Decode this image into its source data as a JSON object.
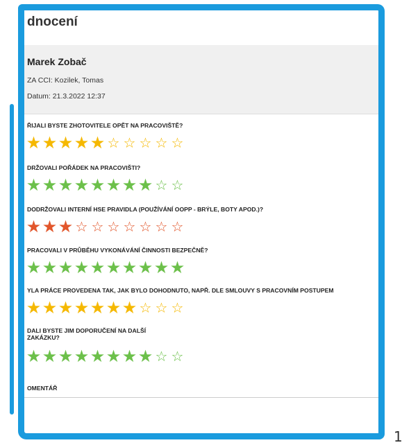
{
  "page_title": "dnocení",
  "card": {
    "name": "Marek Zobač",
    "company": "ZA CCI: Kozilek, Tomas",
    "datum": "Datum: 21.3.2022 12:37"
  },
  "colors": {
    "green": "#6cc04a",
    "gold": "#f5b800",
    "red": "#e2562b",
    "frame": "#1a9bde"
  },
  "icons": {
    "filled": "star-filled-icon",
    "empty": "star-empty-icon"
  },
  "questions": [
    {
      "label": "ŘIJALI BYSTE ZHOTOVITELE OPĚT NA PRACOVIŠTĚ?",
      "rating": 5,
      "max": 10,
      "color": "gold"
    },
    {
      "label": "DRŽOVALI POŘÁDEK NA PRACOVIŠTI?",
      "rating": 8,
      "max": 10,
      "color": "green"
    },
    {
      "label": "DODRŽOVALI INTERNÍ HSE PRAVIDLA (POUŽÍVÁNÍ OOPP - BRÝLE, BOTY APOD.)?",
      "rating": 3,
      "max": 10,
      "color": "red"
    },
    {
      "label": "PRACOVALI V PRŮBĚHU VYKONÁVÁNÍ ČINNOSTI BEZPEČNĚ?",
      "rating": 10,
      "max": 10,
      "color": "green"
    },
    {
      "label": "YLA PRÁCE PROVEDENA TAK, JAK BYLO DOHODNUTO, NAPŘ. DLE SMLOUVY S PRACOVNÍM POSTUPEM",
      "rating": 7,
      "max": 10,
      "color": "gold"
    },
    {
      "label": "DALI BYSTE JIM DOPORUČENÍ NA DALŠÍ ZAKÁZKU?",
      "rating": 8,
      "max": 10,
      "color": "green"
    }
  ],
  "comment_label": "OMENTÁŘ",
  "page_number": "1"
}
